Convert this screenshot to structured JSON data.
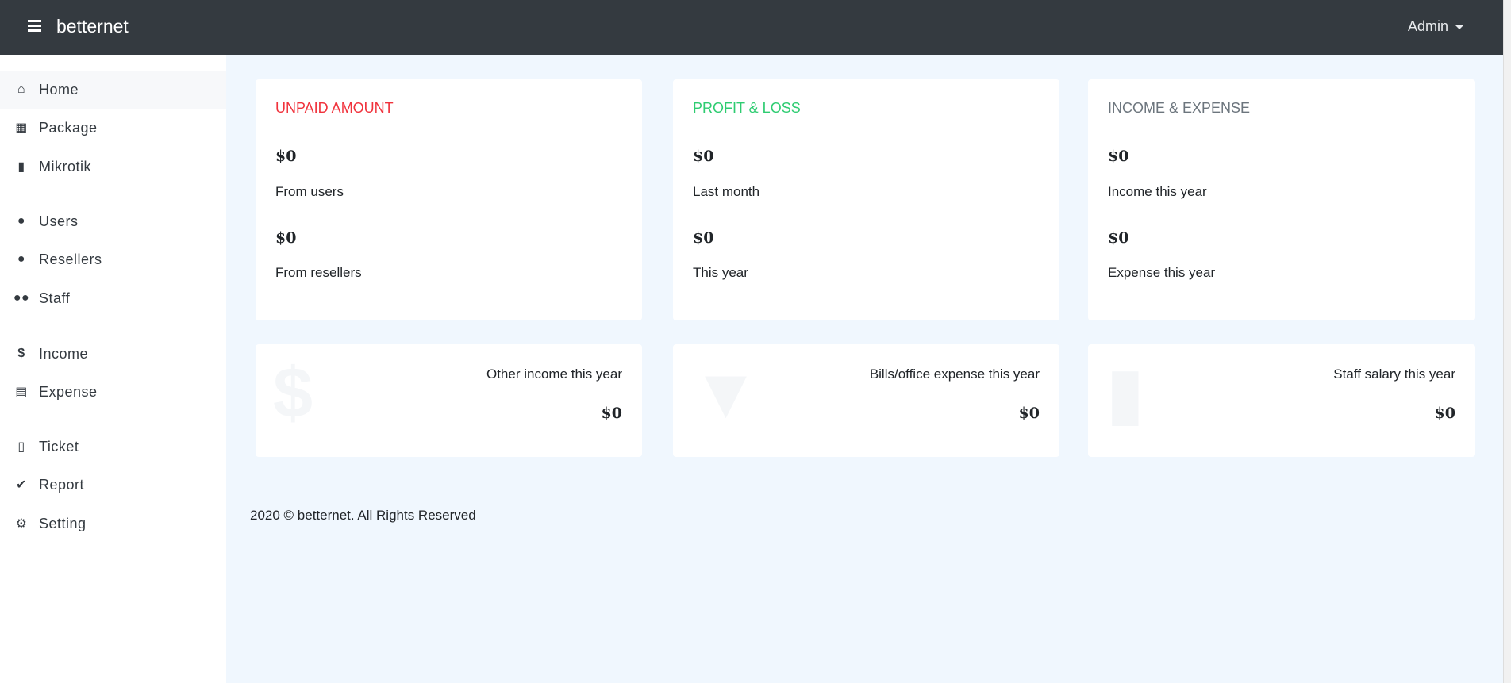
{
  "navbar": {
    "brand": "betternet",
    "user_menu": "Admin"
  },
  "sidebar": {
    "items": [
      {
        "label": "Home",
        "icon": "home-icon"
      },
      {
        "label": "Package",
        "icon": "gift-icon"
      },
      {
        "label": "Mikrotik",
        "icon": "chip-icon"
      },
      {
        "label": "Users",
        "icon": "user-icon"
      },
      {
        "label": "Resellers",
        "icon": "user-tie-icon"
      },
      {
        "label": "Staff",
        "icon": "users-icon"
      },
      {
        "label": "Income",
        "icon": "dollar-icon"
      },
      {
        "label": "Expense",
        "icon": "file-invoice-icon"
      },
      {
        "label": "Ticket",
        "icon": "ticket-icon"
      },
      {
        "label": "Report",
        "icon": "clipboard-check-icon"
      },
      {
        "label": "Setting",
        "icon": "user-cog-icon"
      }
    ]
  },
  "cards": [
    {
      "title": "UNPAID AMOUNT",
      "color": "#f0323c",
      "v1": "$0",
      "l1": "From users",
      "v2": "$0",
      "l2": "From resellers"
    },
    {
      "title": "PROFIT & LOSS",
      "color": "#2ecc71",
      "v1": "$0",
      "l1": "Last month",
      "v2": "$0",
      "l2": "This year"
    },
    {
      "title": "INCOME & EXPENSE",
      "color": "#6c757d",
      "v1": "$0",
      "l1": "Income this year",
      "v2": "$0",
      "l2": "Expense this year"
    }
  ],
  "stats": [
    {
      "label": "Other income this year",
      "value": "$0",
      "icon": "dollar-icon"
    },
    {
      "label": "Bills/office expense this year",
      "value": "$0",
      "icon": "funnel-dollar-icon"
    },
    {
      "label": "Staff salary this year",
      "value": "$0",
      "icon": "invoice-dollar-icon"
    }
  ],
  "footer": "2020 © betternet. All Rights Reserved"
}
